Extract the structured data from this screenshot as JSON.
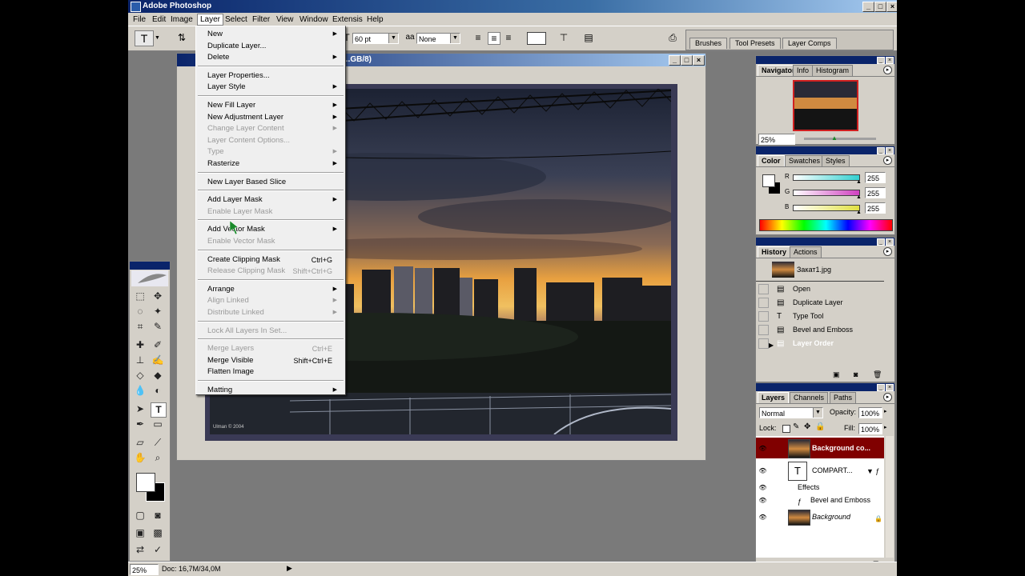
{
  "window": {
    "title": "Adobe Photoshop"
  },
  "menubar": [
    "File",
    "Edit",
    "Image",
    "Layer",
    "Select",
    "Filter",
    "View",
    "Window",
    "Extensis",
    "Help"
  ],
  "options": {
    "size": "60 pt",
    "aa": "aa",
    "antialias": "None"
  },
  "wells": [
    "Brushes",
    "Tool Presets",
    "Layer Comps"
  ],
  "document": {
    "title": "...GB/8)",
    "watermark": "Ulman © 2004"
  },
  "layer_menu": [
    {
      "label": "New",
      "arrow": true
    },
    {
      "label": "Duplicate Layer..."
    },
    {
      "label": "Delete",
      "arrow": true
    },
    {
      "sep": true
    },
    {
      "label": "Layer Properties..."
    },
    {
      "label": "Layer Style",
      "arrow": true
    },
    {
      "sep": true
    },
    {
      "label": "New Fill Layer",
      "arrow": true
    },
    {
      "label": "New Adjustment Layer",
      "arrow": true
    },
    {
      "label": "Change Layer Content",
      "arrow": true,
      "disabled": true
    },
    {
      "label": "Layer Content Options...",
      "disabled": true
    },
    {
      "label": "Type",
      "arrow": true,
      "disabled": true
    },
    {
      "label": "Rasterize",
      "arrow": true
    },
    {
      "sep": true
    },
    {
      "label": "New Layer Based Slice"
    },
    {
      "sep": true
    },
    {
      "label": "Add Layer Mask",
      "arrow": true
    },
    {
      "label": "Enable Layer Mask",
      "disabled": true
    },
    {
      "sep": true
    },
    {
      "label": "Add Vector Mask",
      "arrow": true
    },
    {
      "label": "Enable Vector Mask",
      "disabled": true
    },
    {
      "sep": true
    },
    {
      "label": "Create Clipping Mask",
      "shortcut": "Ctrl+G"
    },
    {
      "label": "Release Clipping Mask",
      "shortcut": "Shift+Ctrl+G",
      "disabled": true
    },
    {
      "sep": true
    },
    {
      "label": "Arrange",
      "arrow": true
    },
    {
      "label": "Align Linked",
      "arrow": true,
      "disabled": true
    },
    {
      "label": "Distribute Linked",
      "arrow": true,
      "disabled": true
    },
    {
      "sep": true
    },
    {
      "label": "Lock All Layers In Set...",
      "disabled": true
    },
    {
      "sep": true
    },
    {
      "label": "Merge Layers",
      "shortcut": "Ctrl+E",
      "disabled": true
    },
    {
      "label": "Merge Visible",
      "shortcut": "Shift+Ctrl+E"
    },
    {
      "label": "Flatten Image"
    },
    {
      "sep": true
    },
    {
      "label": "Matting",
      "arrow": true
    }
  ],
  "navigator": {
    "tabs": [
      "Navigator",
      "Info",
      "Histogram"
    ],
    "zoom": "25%"
  },
  "color": {
    "tabs": [
      "Color",
      "Swatches",
      "Styles"
    ],
    "channels": [
      {
        "name": "R",
        "value": "255",
        "color": "#33d0d0"
      },
      {
        "name": "G",
        "value": "255",
        "color": "#d040c0"
      },
      {
        "name": "B",
        "value": "255",
        "color": "#e0e040"
      }
    ]
  },
  "history": {
    "tabs": [
      "History",
      "Actions"
    ],
    "snapshot": "Закат1.jpg",
    "states": [
      {
        "label": "Open",
        "icon": "doc-icon"
      },
      {
        "label": "Duplicate Layer",
        "icon": "doc-icon"
      },
      {
        "label": "Type Tool",
        "icon": "type-icon"
      },
      {
        "label": "Bevel and Emboss",
        "icon": "doc-icon"
      },
      {
        "label": "Layer Order",
        "icon": "doc-icon",
        "selected": true
      }
    ]
  },
  "layers": {
    "tabs": [
      "Layers",
      "Channels",
      "Paths"
    ],
    "blend": "Normal",
    "opacity_label": "Opacity:",
    "opacity": "100%",
    "lock_label": "Lock:",
    "fill_label": "Fill:",
    "fill": "100%",
    "items": [
      {
        "name": "Background co...",
        "kind": "image",
        "selected": true
      },
      {
        "name": "COMPART...",
        "kind": "type"
      },
      {
        "name": "Effects",
        "kind": "effects"
      },
      {
        "name": "Bevel and Emboss",
        "kind": "effect"
      },
      {
        "name": "Background",
        "kind": "image",
        "italic": true
      }
    ]
  },
  "status": {
    "zoom": "25%",
    "doc": "Doc: 16,7M/34,0M"
  }
}
